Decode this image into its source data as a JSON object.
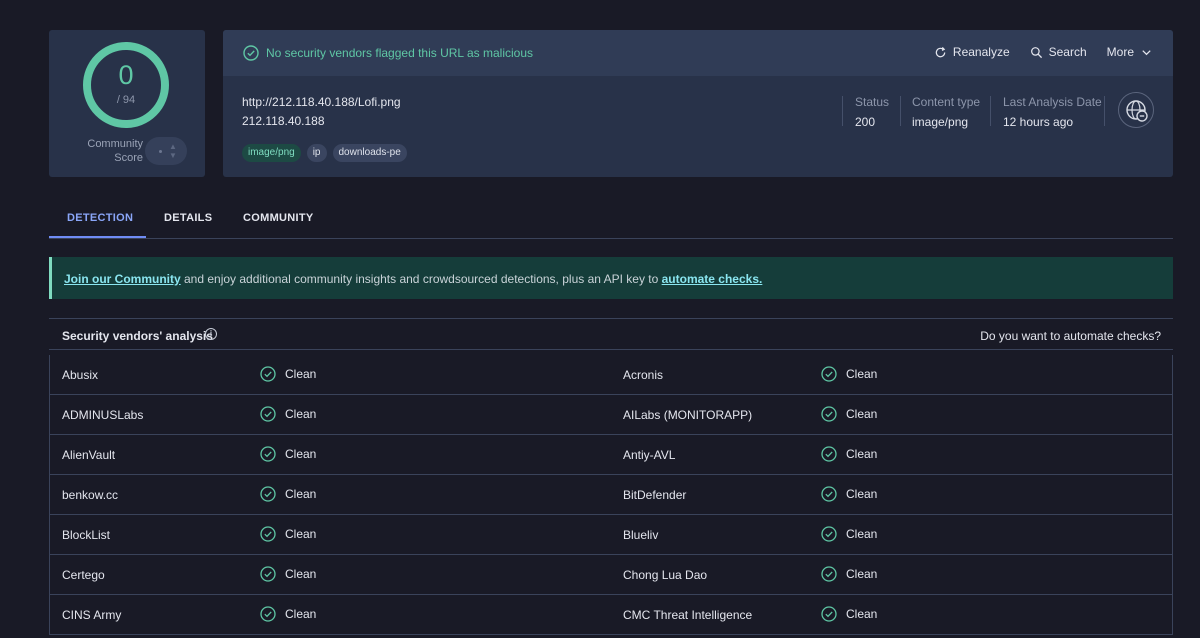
{
  "score": {
    "value": "0",
    "total": "/ 94",
    "community_label": "Community\nScore"
  },
  "verdict": {
    "text": "No security vendors flagged this URL as malicious"
  },
  "actions": {
    "reanalyze": "Reanalyze",
    "search": "Search",
    "more": "More"
  },
  "target": {
    "url": "http://212.118.40.188/Lofi.png",
    "ip": "212.118.40.188",
    "tags": [
      "image/png",
      "ip",
      "downloads-pe"
    ]
  },
  "meta": {
    "status_label": "Status",
    "status_value": "200",
    "content_type_label": "Content type",
    "content_type_value": "image/png",
    "last_analysis_label": "Last Analysis Date",
    "last_analysis_value": "12 hours ago"
  },
  "tabs": [
    "DETECTION",
    "DETAILS",
    "COMMUNITY"
  ],
  "banner": {
    "link1": "Join our Community",
    "middle": " and enjoy additional community insights and crowdsourced detections, plus an API key to ",
    "link2": "automate checks."
  },
  "vendors_section": {
    "title": "Security vendors' analysis",
    "automate_text": "Do you want to automate checks?"
  },
  "vendors": [
    {
      "left": "Abusix",
      "left_result": "Clean",
      "right": "Acronis",
      "right_result": "Clean"
    },
    {
      "left": "ADMINUSLabs",
      "left_result": "Clean",
      "right": "AILabs (MONITORAPP)",
      "right_result": "Clean"
    },
    {
      "left": "AlienVault",
      "left_result": "Clean",
      "right": "Antiy-AVL",
      "right_result": "Clean"
    },
    {
      "left": "benkow.cc",
      "left_result": "Clean",
      "right": "BitDefender",
      "right_result": "Clean"
    },
    {
      "left": "BlockList",
      "left_result": "Clean",
      "right": "Blueliv",
      "right_result": "Clean"
    },
    {
      "left": "Certego",
      "left_result": "Clean",
      "right": "Chong Lua Dao",
      "right_result": "Clean"
    },
    {
      "left": "CINS Army",
      "left_result": "Clean",
      "right": "CMC Threat Intelligence",
      "right_result": "Clean"
    }
  ],
  "colors": {
    "accent_green": "#5fc7a5",
    "tab_active": "#8aa6f8",
    "banner_bg": "#153d3a"
  }
}
